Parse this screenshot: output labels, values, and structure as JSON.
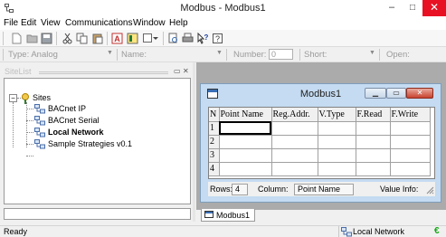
{
  "window": {
    "title": "Modbus - Modbus1",
    "minimize": "–",
    "maximize": "□",
    "close": "✕"
  },
  "menu": [
    "File",
    "Edit",
    "View",
    "Communications",
    "Window",
    "Help"
  ],
  "filter_bar": {
    "type_label": "Type: Analog",
    "name_label": "Name:",
    "number_label": "Number:",
    "number_value": "0",
    "short_label": "Short:",
    "open_label": "Open:"
  },
  "sitelist": {
    "title": "SiteList",
    "items": [
      {
        "label": "Sites",
        "icon": "sites-icon"
      },
      {
        "label": "BACnet IP",
        "icon": "network-icon"
      },
      {
        "label": "BACnet Serial",
        "icon": "network-icon"
      },
      {
        "label": "Local Network",
        "icon": "network-icon",
        "bold": true
      },
      {
        "label": "Sample Strategies v0.1",
        "icon": "network-icon"
      }
    ]
  },
  "child_window": {
    "title": "Modbus1",
    "columns": [
      "N",
      "Point Name",
      "Reg.Addr.",
      "V.Type",
      "F.Read",
      "F.Write"
    ],
    "row_numbers": [
      "1",
      "2",
      "3",
      "4"
    ],
    "status": {
      "rows_label": "Rows:",
      "rows_value": "4",
      "column_label": "Column:",
      "column_value": "Point Name",
      "value_info_label": "Value Info:"
    }
  },
  "doc_tab": {
    "label": "Modbus1"
  },
  "statusbar": {
    "ready": "Ready",
    "network": "Local Network",
    "grip": "€"
  },
  "colors": {
    "close_red": "#e81123",
    "child_frame": "#c4dbf1",
    "mdi_background": "#ababab"
  }
}
